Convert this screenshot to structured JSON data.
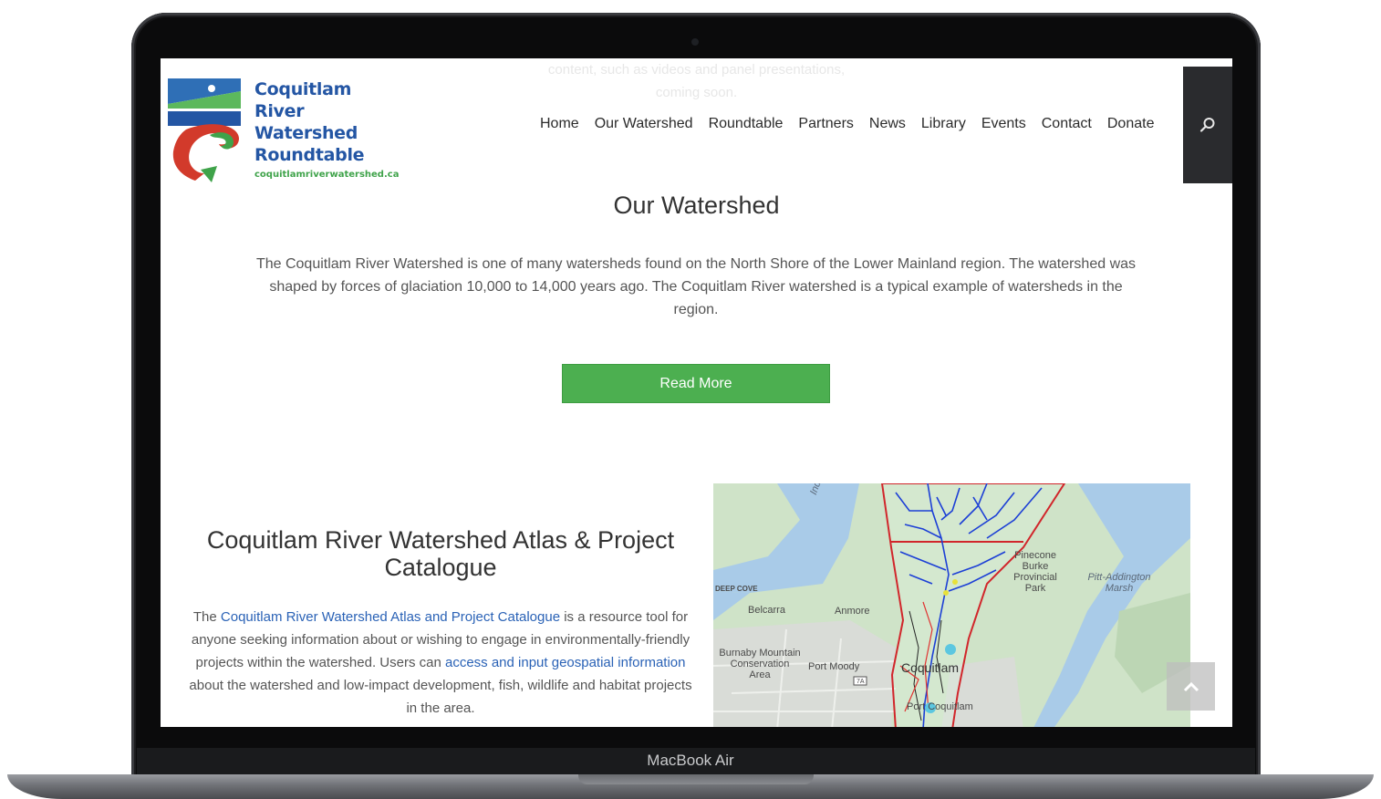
{
  "device": {
    "label": "MacBook Air"
  },
  "page": {
    "faded_lines": [
      "content, such as videos and panel presentations,",
      "coming soon."
    ]
  },
  "logo": {
    "line1": "Coquitlam",
    "line2": "River Watershed",
    "line3": "Roundtable",
    "url": "coquitlamriverwatershed.ca",
    "colors": {
      "blue": "#2456a4",
      "green": "#3fa34a",
      "red": "#d23a2b"
    }
  },
  "nav": {
    "items": [
      "Home",
      "Our Watershed",
      "Roundtable",
      "Partners",
      "News",
      "Library",
      "Events",
      "Contact",
      "Donate"
    ],
    "search_icon": "search-icon"
  },
  "hero": {
    "title": "Our Watershed",
    "text": "The Coquitlam River Watershed is one of many watersheds found on the North Shore of the Lower Mainland region. The watershed was shaped by forces of glaciation 10,000 to 14,000 years ago. The Coquitlam River watershed is a typical example of watersheds in the region.",
    "button": "Read More",
    "button_color": "#4caf50"
  },
  "atlas": {
    "title": "Coquitlam River Watershed Atlas & Project Catalogue",
    "text_1": "The ",
    "link_1": "Coquitlam River Watershed Atlas and Project Catalogue",
    "text_2": " is a resource tool for anyone seeking information about or wishing to engage in environmentally-friendly projects within the watershed. Users can ",
    "link_2": "access and input geospatial information",
    "text_3": " about the watershed and low-impact development, fish, wildlife and habitat projects in the area.",
    "link_color": "#2a62b6"
  },
  "map": {
    "labels": {
      "indian_arm": "Indian Arm",
      "deep_cove": "DEEP COVE",
      "belcarra": "Belcarra",
      "anmore": "Anmore",
      "burnaby": "Burnaby Mountain Conservation Area",
      "port_moody": "Port Moody",
      "highway": "7A",
      "coquitlam": "Coquitlam",
      "port_coquitlam": "Port Coquitlam",
      "pinecone": "Pinecone Burke Provincial Park",
      "pitt": "Pitt-Addington Marsh"
    }
  },
  "back_to_top_icon": "chevron-up-icon"
}
